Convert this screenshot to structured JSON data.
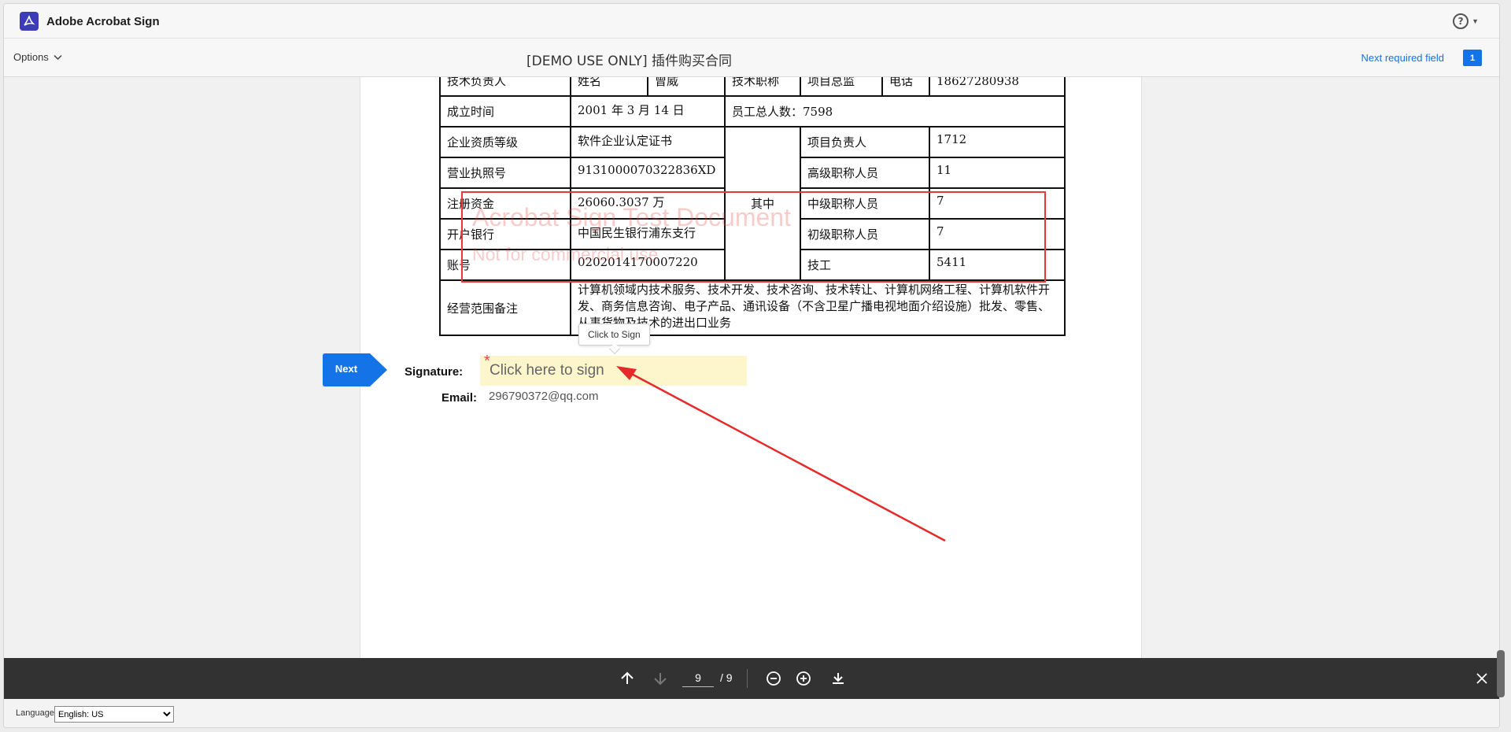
{
  "app": {
    "logo_glyph": "⅄",
    "title": "Adobe Acrobat Sign",
    "help_icon": "?"
  },
  "subheader": {
    "options_label": "Options",
    "doc_title": "[DEMO USE ONLY] 插件购买合同",
    "next_required_label": "Next required field",
    "required_count": "1"
  },
  "table": {
    "row0": [
      "技术负责人",
      "姓名",
      "曾威",
      "技术职称",
      "项目总监",
      "电话",
      "18627280938"
    ],
    "row1": {
      "label": "成立时间",
      "value": "2001 年 3 月 14 日",
      "employees": "员工总人数：7598"
    },
    "row2": {
      "label": "企业资质等级",
      "value": "软件企业认定证书",
      "sub_label": "项目负责人",
      "sub_value": "1712"
    },
    "row3": {
      "label": "营业执照号",
      "value": "9131000070322836XD",
      "sub_label": "高级职称人员",
      "sub_value": "11"
    },
    "row4": {
      "label": "注册资金",
      "value": "26060.3037 万",
      "group_label": "其中",
      "sub_label": "中级职称人员",
      "sub_value": "7"
    },
    "row5": {
      "label": "开户银行",
      "value": "中国民生银行浦东支行",
      "sub_label": "初级职称人员",
      "sub_value": "7"
    },
    "row6": {
      "label": "账号",
      "value": "0202014170007220",
      "sub_label": "技工",
      "sub_value": "5411"
    },
    "row7": {
      "label": "经营范围备注",
      "value": "计算机领域内技术服务、技术开发、技术咨询、技术转让、计算机网络工程、计算机软件开发、商务信息咨询、电子产品、通讯设备（不含卫星广播电视地面介绍设施）批发、零售、从事货物及技术的进出口业务"
    }
  },
  "watermark": {
    "line1": "Acrobat Sign Test Document",
    "line2": "Not for commercial use",
    "box_color": "#e63a3a"
  },
  "signing": {
    "next_button": "Next",
    "signature_label": "Signature:",
    "signature_placeholder": "Click here to sign",
    "required_marker": "*",
    "tooltip": "Click to Sign",
    "email_label": "Email:",
    "email_value": "296790372@qq.com",
    "field_color": "#fdf5cc",
    "accent": "#1473e6"
  },
  "toolbar": {
    "current_page": "9",
    "total_pages": "/ 9"
  },
  "footer": {
    "language_label": "Language",
    "language_value": "English: US"
  }
}
